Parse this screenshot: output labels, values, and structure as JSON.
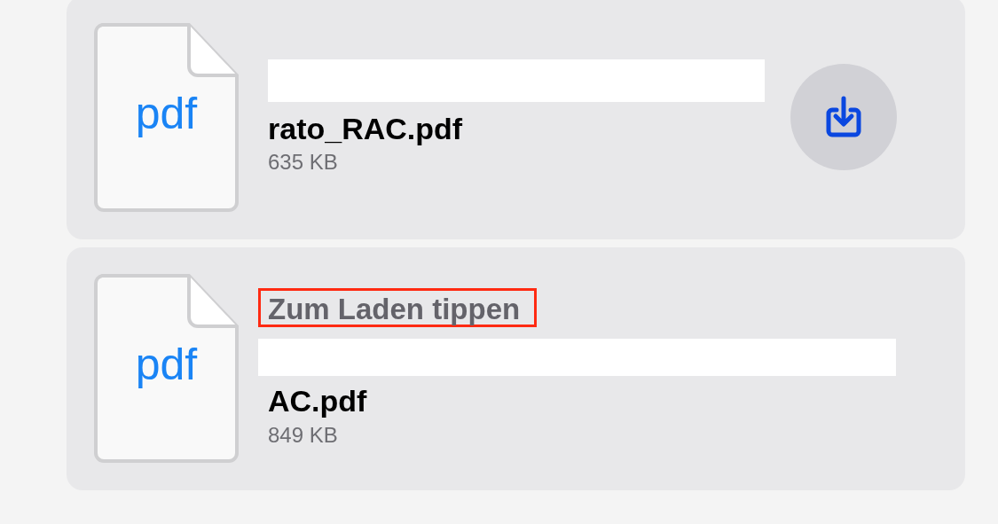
{
  "files": [
    {
      "name": "rato_RAC.pdf",
      "size": "635 KB",
      "type_label": "pdf",
      "redacted": true,
      "downloadable": true
    },
    {
      "hint": "Zum Laden tippen",
      "hint_highlighted": true,
      "name": "AC.pdf",
      "size": "849 KB",
      "type_label": "pdf",
      "redacted": true,
      "downloadable": false
    }
  ]
}
